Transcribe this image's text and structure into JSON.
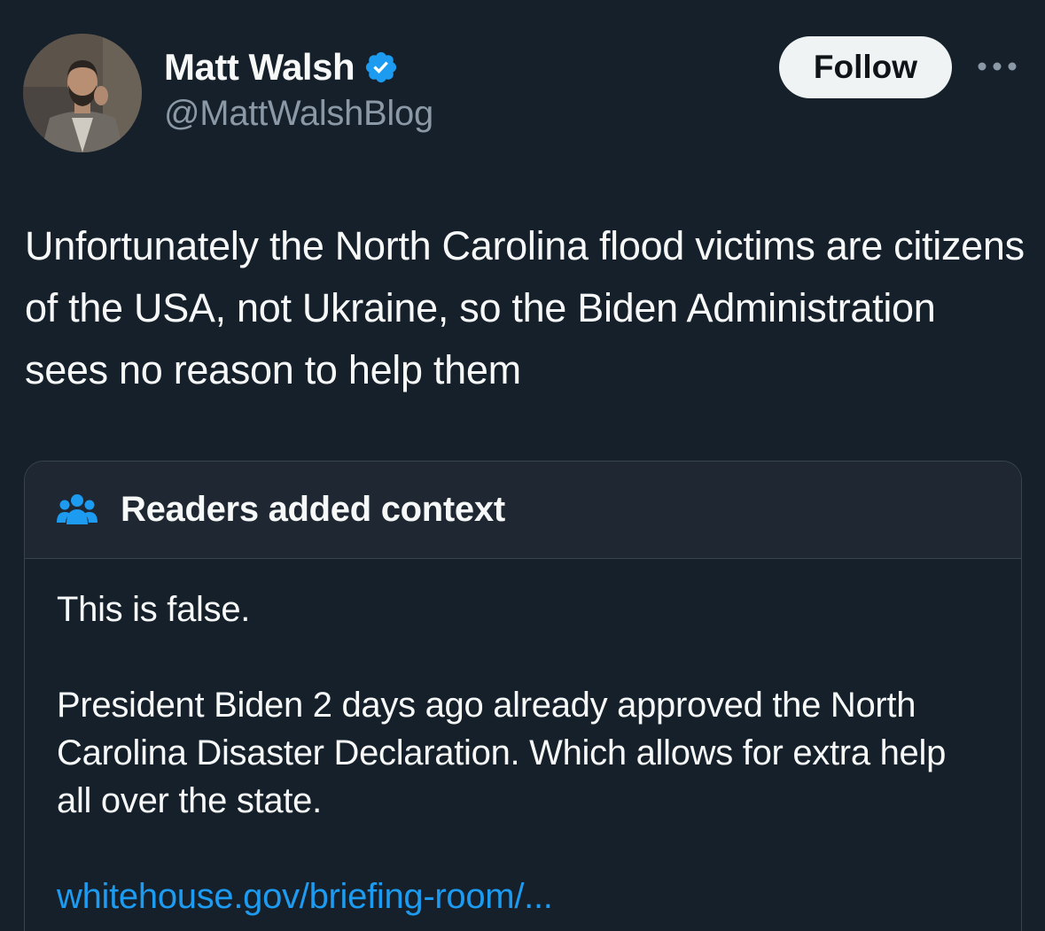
{
  "author": {
    "name": "Matt Walsh",
    "handle": "@MattWalshBlog",
    "verified": true,
    "avatar": "profile-photo"
  },
  "actions": {
    "follow_label": "Follow",
    "more_icon": "more-horizontal-icon"
  },
  "post": {
    "text": "Unfortunately the North Carolina flood victims are citizens of the USA, not Ukraine, so the Biden Administration sees no reason to help them"
  },
  "community_note": {
    "icon": "people-icon",
    "title": "Readers added context",
    "paragraph_1": "This is false.",
    "paragraph_2": "President Biden 2 days ago already approved the North Carolina Disaster Declaration. Which allows for extra help all over the state.",
    "link_text": "whitehouse.gov/briefing-room/..."
  },
  "colors": {
    "background": "#15202b",
    "accent": "#1d9bf0",
    "secondary_text": "#8b98a5",
    "border": "#38444d",
    "note_header_bg": "#1e2732"
  }
}
